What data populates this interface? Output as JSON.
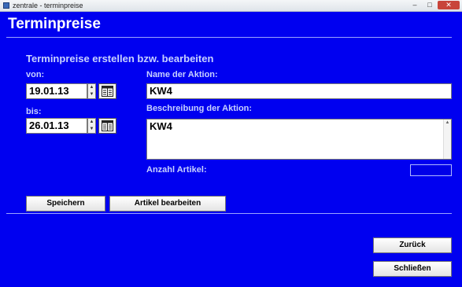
{
  "window": {
    "title": "zentrale - terminpreise",
    "controls": {
      "minimize": "–",
      "maximize": "□",
      "close": "✕"
    }
  },
  "page": {
    "heading": "Terminpreise",
    "subheading": "Terminpreise erstellen bzw. bearbeiten"
  },
  "form": {
    "von_label": "von:",
    "von_value": "19.01.13",
    "bis_label": "bis:",
    "bis_value": "26.01.13",
    "name_label": "Name der Aktion:",
    "name_value": "KW4",
    "desc_label": "Beschreibung der Aktion:",
    "desc_value": "KW4",
    "count_label": "Anzahl Artikel:",
    "count_value": ""
  },
  "buttons": {
    "save": "Speichern",
    "edit_items": "Artikel bearbeiten",
    "back": "Zurück",
    "close": "Schließen"
  },
  "icons": {
    "calendar": "calendar-icon",
    "spin_up": "▲",
    "spin_down": "▼"
  }
}
